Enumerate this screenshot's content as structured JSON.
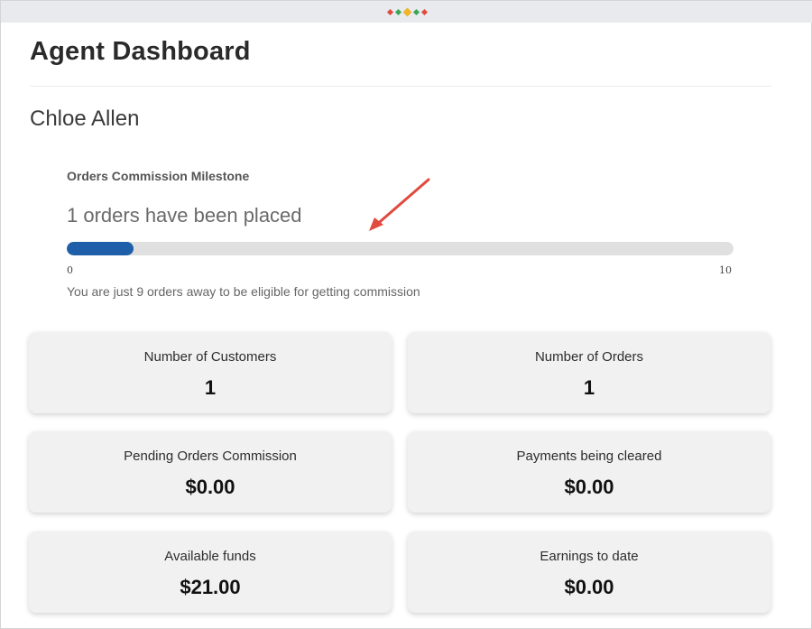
{
  "header": {
    "title": "Agent Dashboard",
    "agent_name": "Chloe Allen"
  },
  "milestone": {
    "title": "Orders Commission Milestone",
    "status": "1 orders have been placed",
    "progress_value": 1,
    "progress_max": 10,
    "min_label": "0",
    "max_label": "10",
    "note": "You are just 9 orders away to be eligible for getting commission"
  },
  "stats": [
    {
      "label": "Number of Customers",
      "value": "1"
    },
    {
      "label": "Number of Orders",
      "value": "1"
    },
    {
      "label": "Pending Orders Commission",
      "value": "$0.00"
    },
    {
      "label": "Payments being cleared",
      "value": "$0.00"
    },
    {
      "label": "Available funds",
      "value": "$21.00"
    },
    {
      "label": "Earnings to date",
      "value": "$0.00"
    }
  ],
  "colors": {
    "progress_fill": "#1f5ea8",
    "progress_track": "#e0e0e0",
    "annotation_arrow": "#e04a3f",
    "card_background": "#f1f1f1",
    "topbar_background": "#e9eaee"
  },
  "topbar": {
    "decoration_icon": "dots-diamond-icon",
    "dot_colors": [
      "#e04a3f",
      "#3aa655",
      "#f0b429",
      "#3aa655",
      "#e04a3f"
    ]
  }
}
